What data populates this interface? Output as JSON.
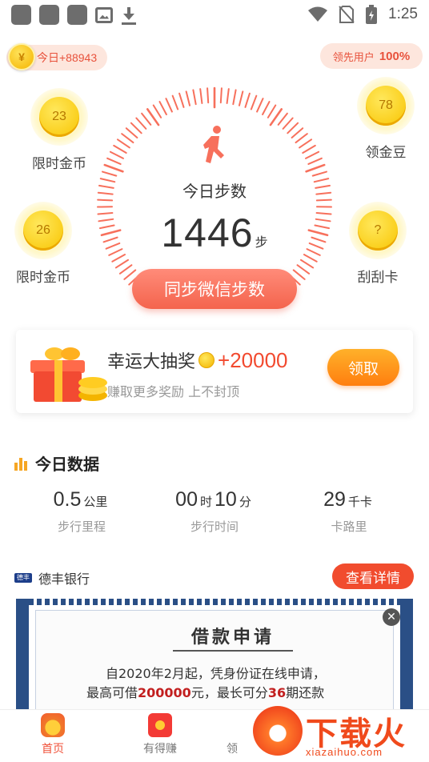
{
  "status_bar": {
    "time": "1:25",
    "icons": [
      "app-icon",
      "app-icon",
      "app-icon",
      "image-icon",
      "download-icon",
      "wifi-icon",
      "no-sim-icon",
      "battery-icon"
    ]
  },
  "top": {
    "today_coins_label": "今日+88943",
    "coin_symbol": "¥",
    "leading_label": "领先用户",
    "leading_value": "100%"
  },
  "bubbles": [
    {
      "value": "23",
      "label": "限时金币"
    },
    {
      "value": "78",
      "label": "领金豆"
    },
    {
      "value": "26",
      "label": "限时金币"
    },
    {
      "value": "?",
      "label": "刮刮卡"
    }
  ],
  "dial": {
    "title": "今日步数",
    "steps": "1446",
    "unit": "步",
    "sync_button": "同步微信步数",
    "accent": "#f7705c"
  },
  "lottery": {
    "title": "幸运大抽奖",
    "amount": "+20000",
    "subtitle": "赚取更多奖励 上不封顶",
    "button": "领取"
  },
  "today": {
    "title": "今日数据",
    "stats": [
      {
        "parts": [
          {
            "v": "0.5",
            "size": "big"
          },
          {
            "v": "公里",
            "size": "sm"
          }
        ],
        "label": "步行里程"
      },
      {
        "parts": [
          {
            "v": "00",
            "size": "big"
          },
          {
            "v": "时",
            "size": "sm"
          },
          {
            "v": "10",
            "size": "big"
          },
          {
            "v": "分",
            "size": "sm"
          }
        ],
        "label": "步行时间"
      },
      {
        "parts": [
          {
            "v": "29",
            "size": "big"
          },
          {
            "v": "千卡",
            "size": "sm"
          }
        ],
        "label": "卡路里"
      }
    ]
  },
  "ad": {
    "bank_logo": "德丰",
    "bank_name": "德丰银行",
    "detail_button": "查看详情",
    "title": "借款申请",
    "line1": "自2020年2月起，凭身份证在线申请，",
    "line2_pre": "最高可借",
    "line2_amount": "200000",
    "line2_mid": "元，最长可分",
    "line2_periods": "36",
    "line2_post": "期还款",
    "close": "✕"
  },
  "bottom_nav": {
    "items": [
      {
        "label": "首页",
        "active": true
      },
      {
        "label": "有得赚",
        "active": false
      },
      {
        "label": "领",
        "active": false
      }
    ]
  },
  "watermark": {
    "text": "下载火",
    "url": "xiazaihuo.com"
  }
}
